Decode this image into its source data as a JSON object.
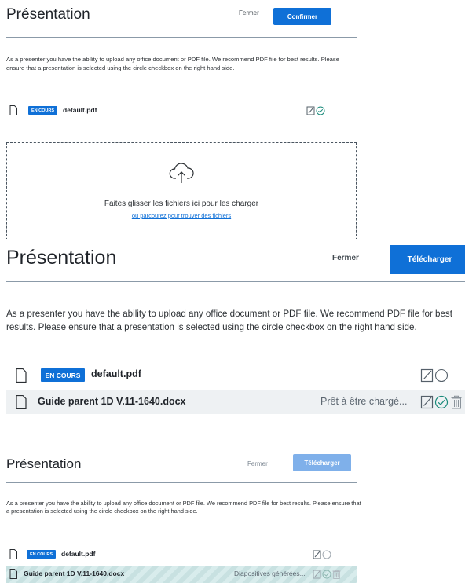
{
  "panel1": {
    "title": "Présentation",
    "close_label": "Fermer",
    "confirm_label": "Confirmer",
    "description": "As a presenter you have the ability to upload any office document or PDF file. We recommend PDF file for best results. Please ensure that a presentation is selected using the circle checkbox on the right hand side.",
    "files": [
      {
        "badge": "EN COURS",
        "name": "default.pdf",
        "selected": true
      }
    ],
    "dropzone": {
      "text": "Faites glisser les fichiers ici pour les charger",
      "link": "ou parcourez pour trouver des fichiers",
      "icon": "cloud-upload-icon"
    }
  },
  "panel2": {
    "title": "Présentation",
    "close_label": "Fermer",
    "upload_label": "Télécharger",
    "description": "As a presenter you have the ability to upload any office document or PDF file. We recommend PDF file for best results. Please ensure that a presentation is selected using the circle checkbox on the right hand side.",
    "files": [
      {
        "badge": "EN COURS",
        "name": "default.pdf",
        "status": "",
        "selected": false
      },
      {
        "badge": "",
        "name": "Guide parent 1D V.11-1640.docx",
        "status": "Prêt à être chargé...",
        "selected": true
      }
    ]
  },
  "panel3": {
    "title": "Présentation",
    "close_label": "Fermer",
    "upload_label": "Télécharger",
    "description": "As a presenter you have the ability to upload any office document or PDF file. We recommend PDF file for best results. Please ensure that a presentation is selected using the circle checkbox on the right hand side.",
    "files": [
      {
        "badge": "EN COURS",
        "name": "default.pdf",
        "status": "",
        "selected": false
      },
      {
        "badge": "",
        "name": "Guide parent 1D V.11-1640.docx",
        "status": "Diapositives générées...",
        "selected": true
      }
    ]
  },
  "colors": {
    "accent": "#0f70d7",
    "accent_disabled": "#7fb0ea",
    "check_green": "#1a8a7a",
    "rule": "#8b9aa8",
    "progress_stripe": "#c8e1e1"
  }
}
